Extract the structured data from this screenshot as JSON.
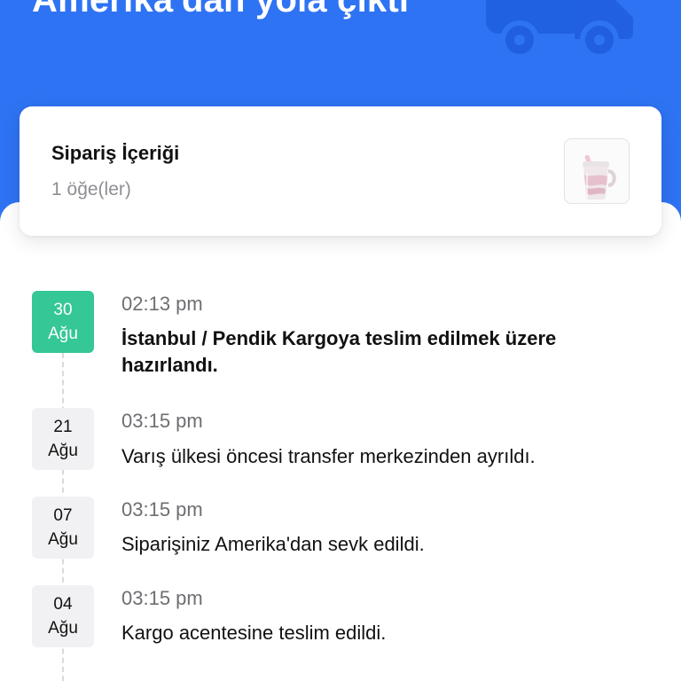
{
  "header": {
    "title": "Amerika'dan yola çıktı",
    "bg_color": "#2e73f3",
    "truck_icon": "truck-icon"
  },
  "order": {
    "title": "Sipariş İçeriği",
    "count": "1 öğe(ler)",
    "thumbnail_icon": "tumbler-product-icon"
  },
  "events": [
    {
      "day": "30",
      "month": "Ağu",
      "time": "02:13 pm",
      "desc": "İstanbul / Pendik Kargoya teslim edilmek üzere hazırlandı.",
      "active": true
    },
    {
      "day": "21",
      "month": "Ağu",
      "time": "03:15 pm",
      "desc": "Varış ülkesi öncesi transfer merkezinden ayrıldı.",
      "active": false
    },
    {
      "day": "07",
      "month": "Ağu",
      "time": "03:15 pm",
      "desc": "Siparişiniz Amerika'dan sevk edildi.",
      "active": false
    },
    {
      "day": "04",
      "month": "Ağu",
      "time": "03:15 pm",
      "desc": "Kargo acentesine teslim edildi.",
      "active": false
    }
  ],
  "colors": {
    "active_badge": "#35c795",
    "inactive_badge": "#f1f1f3"
  }
}
